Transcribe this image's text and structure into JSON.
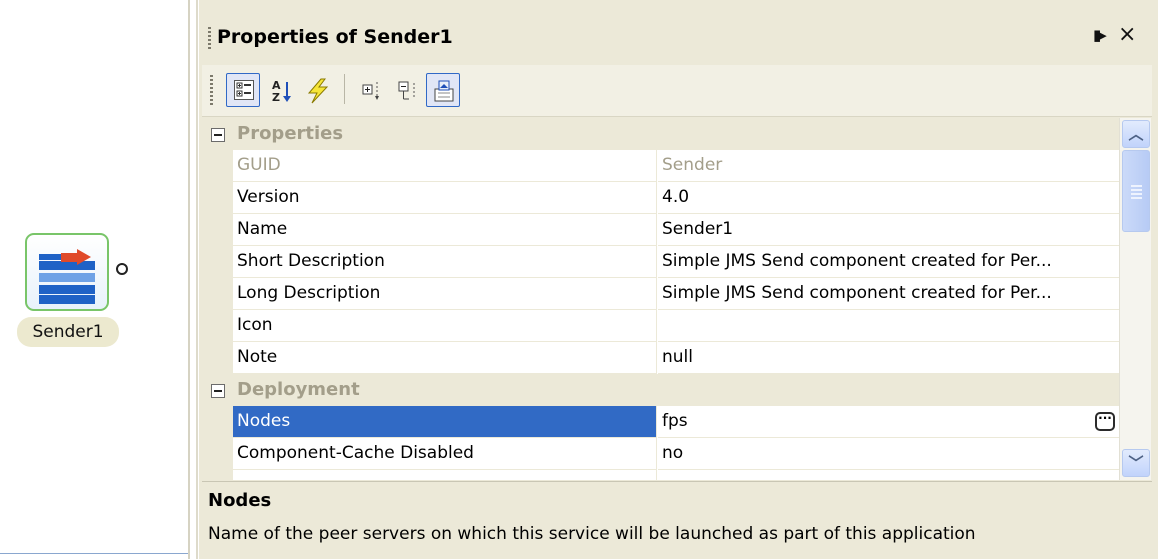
{
  "canvas": {
    "component": {
      "label": "Sender1",
      "icon": "sender-component-icon"
    }
  },
  "panel": {
    "title": "Properties of Sender1",
    "pin_glyph": "▮▸",
    "close_glyph": "×"
  },
  "toolbar": {
    "buttons": [
      {
        "name": "categorized-view-button",
        "icon": "categorized-icon",
        "active": true
      },
      {
        "name": "alphabetical-sort-button",
        "icon": "sort-az-icon",
        "active": false
      },
      {
        "name": "events-button",
        "icon": "lightning-icon",
        "active": false
      },
      {
        "name": "expand-all-button",
        "icon": "expand-icon",
        "active": false
      },
      {
        "name": "collapse-all-button",
        "icon": "collapse-icon",
        "active": false
      },
      {
        "name": "property-pages-button",
        "icon": "property-pages-icon",
        "active": true
      }
    ]
  },
  "grid": {
    "categories": [
      {
        "label": "Properties",
        "rows": [
          {
            "name": "GUID",
            "value": "Sender",
            "disabled": true
          },
          {
            "name": "Version",
            "value": "4.0"
          },
          {
            "name": "Name",
            "value": "Sender1"
          },
          {
            "name": "Short Description",
            "value": "Simple JMS Send component created for Per..."
          },
          {
            "name": "Long Description",
            "value": "Simple JMS Send component created for Per..."
          },
          {
            "name": "Icon",
            "value": ""
          },
          {
            "name": "Note",
            "value": "null"
          }
        ]
      },
      {
        "label": "Deployment",
        "rows": [
          {
            "name": "Nodes",
            "value": "fps",
            "selected": true,
            "has_ellipsis": true
          },
          {
            "name": "Component-Cache Disabled",
            "value": "no"
          }
        ]
      }
    ]
  },
  "description": {
    "title": "Nodes",
    "text": "Name of the peer servers on which this service will be launched as part of this application"
  },
  "colors": {
    "selection": "#316ac5",
    "panel_bg": "#ece9d8",
    "component_border": "#79c569"
  }
}
